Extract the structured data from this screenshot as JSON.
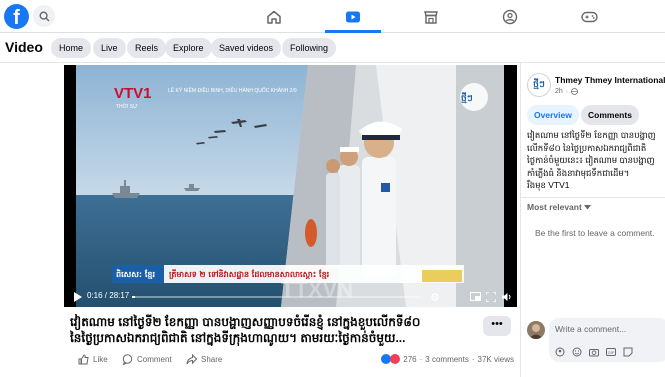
{
  "header": {
    "logo": "f",
    "nav": [
      {
        "name": "home-icon"
      },
      {
        "name": "video-icon",
        "active": true
      },
      {
        "name": "marketplace-icon"
      },
      {
        "name": "groups-icon"
      },
      {
        "name": "gaming-icon"
      }
    ]
  },
  "subheader": {
    "title": "Video",
    "tabs": [
      "Home",
      "Live",
      "Reels",
      "Explore",
      "Saved videos",
      "Following"
    ]
  },
  "video": {
    "current_time": "0:16 / 28:17",
    "progress": 0.01,
    "overlay": {
      "channel_logo": "VTV1",
      "channel_sub": "THỜI SỰ",
      "ticker_line": "LỄ KỶ NIỆM ĐIỀU BINH, DIỄU HÀNH QUỐC KHÁNH 2/9",
      "watermark": "TTXVN",
      "brand_logo": "ថ្មីៗ",
      "subtitle_label": "ពិសេស: ខ្មែរ",
      "subtitle_text": "ត្រីមាសទ ២ ទៅនិវាសដ្ឋាន ដែលមានសាលាស្ដោះ ខ្មែរ"
    }
  },
  "post": {
    "caption_line1": "វៀតណាម នៅថ្ងៃទី២ ខែកញ្ញា បានបង្ហាញសញ្ញាបទចំរើនខ្ញុំ នៅក្នុងខួបលើកទី៨០",
    "caption_line2": "នៃថ្ងៃប្រកាសឯករាជ្យពិជាតិ នៅក្នុងទីក្រុងហាណូយ។ តាមរយៈថ្ងៃកាន់ចំមួយ...",
    "more": "•••",
    "like": "Like",
    "comment": "Comment",
    "share": "Share",
    "reaction_count": "276",
    "comments": "3 comments",
    "views": "37K views"
  },
  "panel": {
    "channel_name": "Thmey Thmey International",
    "channel_avatar_text": "ថ្មីៗ",
    "time_ago": "2h",
    "tab_overview": "Overview",
    "tab_comments": "Comments",
    "description": [
      "វៀតណាម នៅថ្ងៃទី២ ខែកញ្ញា បានបង្ហាញ",
      "លើកទី៨០ នៃថ្ងៃប្រកាសឯករាជ្យពិជាតិ",
      "ថ្ងៃកាន់ចំមួយនេះ៖ វៀតណាម បានបង្ហាញ",
      "កាំភ្លើងធំ និងនាវាមុជទឹកជាដើម។",
      "រឹងមុខ VTV1"
    ],
    "sort_label": "Most relevant",
    "empty_text": "Be the first to leave a comment.",
    "comment_placeholder": "Write a comment..."
  },
  "colors": {
    "brand": "#1877f2",
    "sea": "#2a5a80",
    "sky": "#a9c5dc"
  }
}
